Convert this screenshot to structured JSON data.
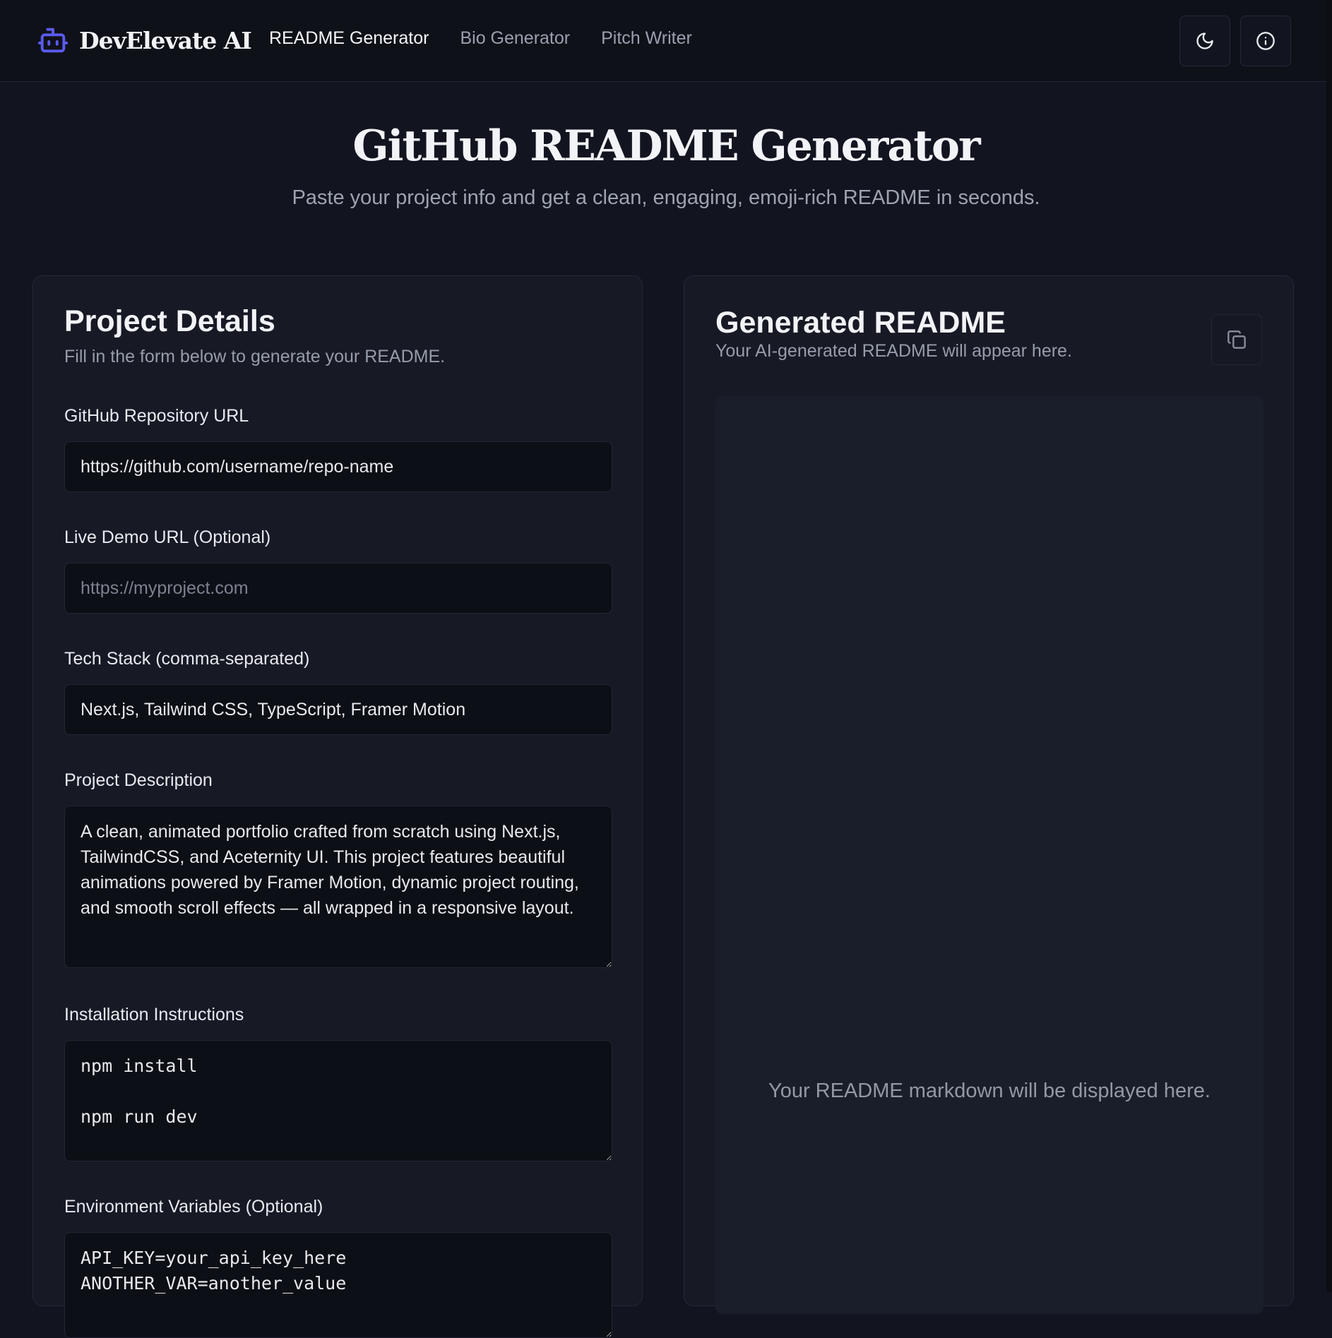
{
  "app": {
    "brand_name": "DevElevate AI",
    "accent_color": "#5b5bf0"
  },
  "nav": {
    "items": [
      {
        "label": "README Generator",
        "active": true
      },
      {
        "label": "Bio Generator",
        "active": false
      },
      {
        "label": "Pitch Writer",
        "active": false
      }
    ]
  },
  "header_icons": {
    "theme": "moon-icon",
    "info": "info-icon"
  },
  "hero": {
    "title": "GitHub README Generator",
    "subtitle": "Paste your project info and get a clean, engaging, emoji-rich README in seconds."
  },
  "form": {
    "title": "Project Details",
    "subtitle": "Fill in the form below to generate your README.",
    "repo_url": {
      "label": "GitHub Repository URL",
      "value": "https://github.com/username/repo-name",
      "placeholder": ""
    },
    "demo_url": {
      "label": "Live Demo URL (Optional)",
      "value": "",
      "placeholder": "https://myproject.com"
    },
    "tech_stack": {
      "label": "Tech Stack (comma-separated)",
      "value": "Next.js, Tailwind CSS, TypeScript, Framer Motion"
    },
    "description": {
      "label": "Project Description",
      "value": "A clean, animated portfolio crafted from scratch using Next.js, TailwindCSS, and Aceternity UI. This project features beautiful animations powered by Framer Motion, dynamic project routing, and smooth scroll effects — all wrapped in a responsive layout."
    },
    "installation": {
      "label": "Installation Instructions",
      "value": "npm install\n\nnpm run dev"
    },
    "env_vars": {
      "label": "Environment Variables (Optional)",
      "value": "API_KEY=your_api_key_here\nANOTHER_VAR=another_value"
    }
  },
  "output": {
    "title": "Generated README",
    "subtitle": "Your AI-generated README will appear here.",
    "copy_icon": "copy-icon",
    "placeholder": "Your README markdown will be displayed here."
  }
}
